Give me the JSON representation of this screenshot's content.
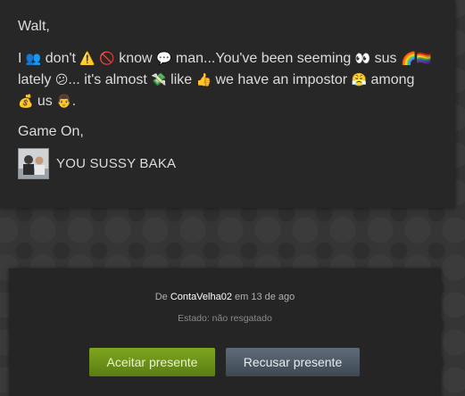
{
  "message": {
    "greeting": "Walt,",
    "segments": [
      {
        "t": "I "
      },
      {
        "e": "👥"
      },
      {
        "t": " don't "
      },
      {
        "e": "⚠️"
      },
      {
        "t": " "
      },
      {
        "e": "🚫"
      },
      {
        "t": " know "
      },
      {
        "e": "💬"
      },
      {
        "t": " man...You've been seeming "
      },
      {
        "e": "👀"
      },
      {
        "t": " sus "
      },
      {
        "e": "🌈"
      },
      {
        "e": "🏳️‍🌈"
      },
      {
        "t": " lately "
      },
      {
        "e": "😕"
      },
      {
        "t": "... it's almost "
      },
      {
        "e": "💸"
      },
      {
        "t": " like "
      },
      {
        "e": "👍"
      },
      {
        "t": " we have an impostor "
      },
      {
        "e": "😤"
      },
      {
        "t": " among "
      },
      {
        "e": "💰"
      },
      {
        "t": " us "
      },
      {
        "e": "👨"
      },
      {
        "t": "."
      }
    ],
    "signoff": "Game On,",
    "signature": "YOU SUSSY BAKA"
  },
  "gift": {
    "from_prefix": "De",
    "from_user": "ContaVelha02",
    "from_suffix": "em 13 de ago",
    "status": "Estado: não resgatado",
    "accept_label": "Aceitar presente",
    "decline_label": "Recusar presente"
  },
  "colors": {
    "accept_green": "#6a8f1a",
    "decline_gray": "#4f5964",
    "card_bg": "#272727"
  }
}
